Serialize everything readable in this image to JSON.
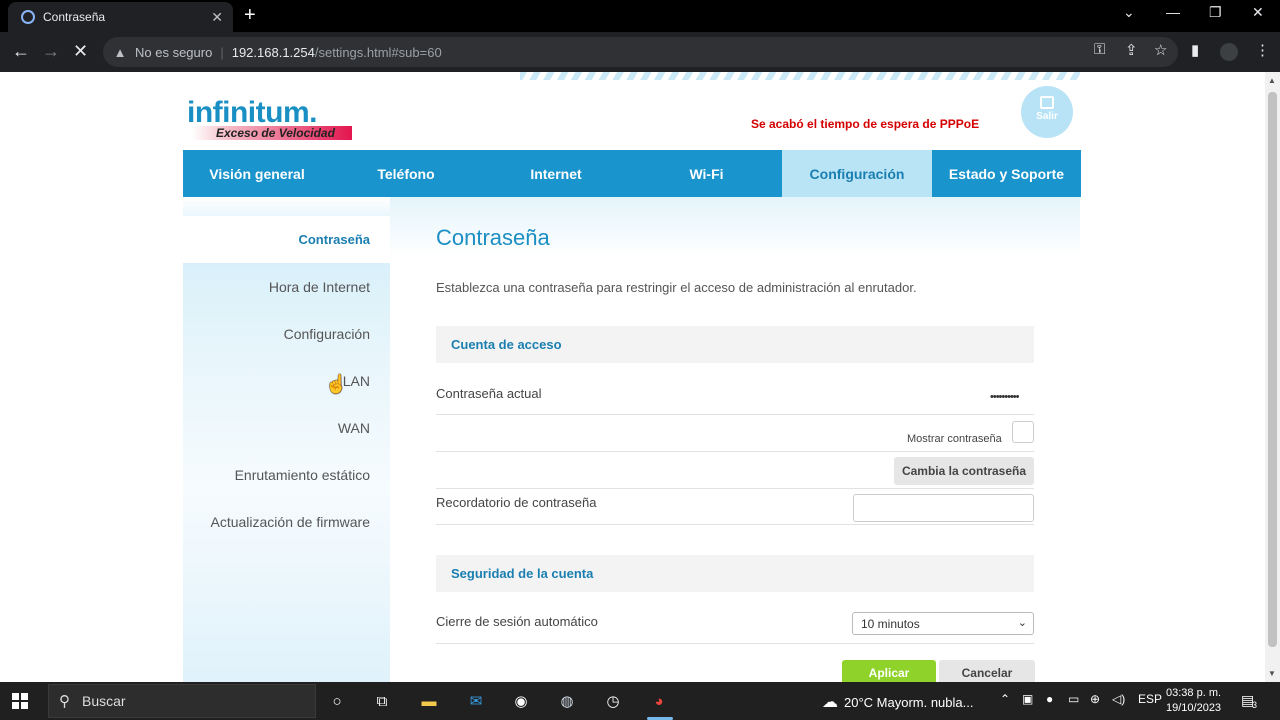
{
  "browser": {
    "tab_title": "Contraseña",
    "security_label": "No es seguro",
    "url_host": "192.168.1.254",
    "url_path": "/settings.html#sub=60"
  },
  "header": {
    "brand": "infinitum.",
    "slogan": "Exceso de Velocidad",
    "alert": "Se acabó el tiempo de espera de PPPoE",
    "logout_label": "Salir"
  },
  "nav": {
    "items": [
      "Visión general",
      "Teléfono",
      "Internet",
      "Wi-Fi",
      "Configuración",
      "Estado y Soporte"
    ],
    "active_index": 4
  },
  "sidebar": {
    "items": [
      "Contraseña",
      "Hora de Internet",
      "Configuración",
      "LAN",
      "WAN",
      "Enrutamiento estático",
      "Actualización de firmware"
    ],
    "active_index": 0
  },
  "main": {
    "title": "Contraseña",
    "description": "Establezca una contraseña para restringir el acceso de administración al enrutador.",
    "section_account": "Cuenta de acceso",
    "current_password_label": "Contraseña actual",
    "current_password_value": "••••••••••",
    "show_password_label": "Mostrar contraseña",
    "change_password_button": "Cambia la contraseña",
    "reminder_label": "Recordatorio de contraseña",
    "reminder_value": "",
    "section_security": "Seguridad de la cuenta",
    "auto_logout_label": "Cierre de sesión automático",
    "auto_logout_value": "10 minutos",
    "apply_button": "Aplicar",
    "cancel_button": "Cancelar"
  },
  "taskbar": {
    "search_placeholder": "Buscar",
    "weather": "20°C  Mayorm. nubla...",
    "language": "ESP",
    "time": "03:38 p. m.",
    "date": "19/10/2023",
    "notification_count": "3"
  },
  "colors": {
    "brand_blue": "#1a94cc",
    "nav_active_bg": "#b9e4f6",
    "alert_red": "#d40000",
    "apply_green": "#8fd32a"
  }
}
